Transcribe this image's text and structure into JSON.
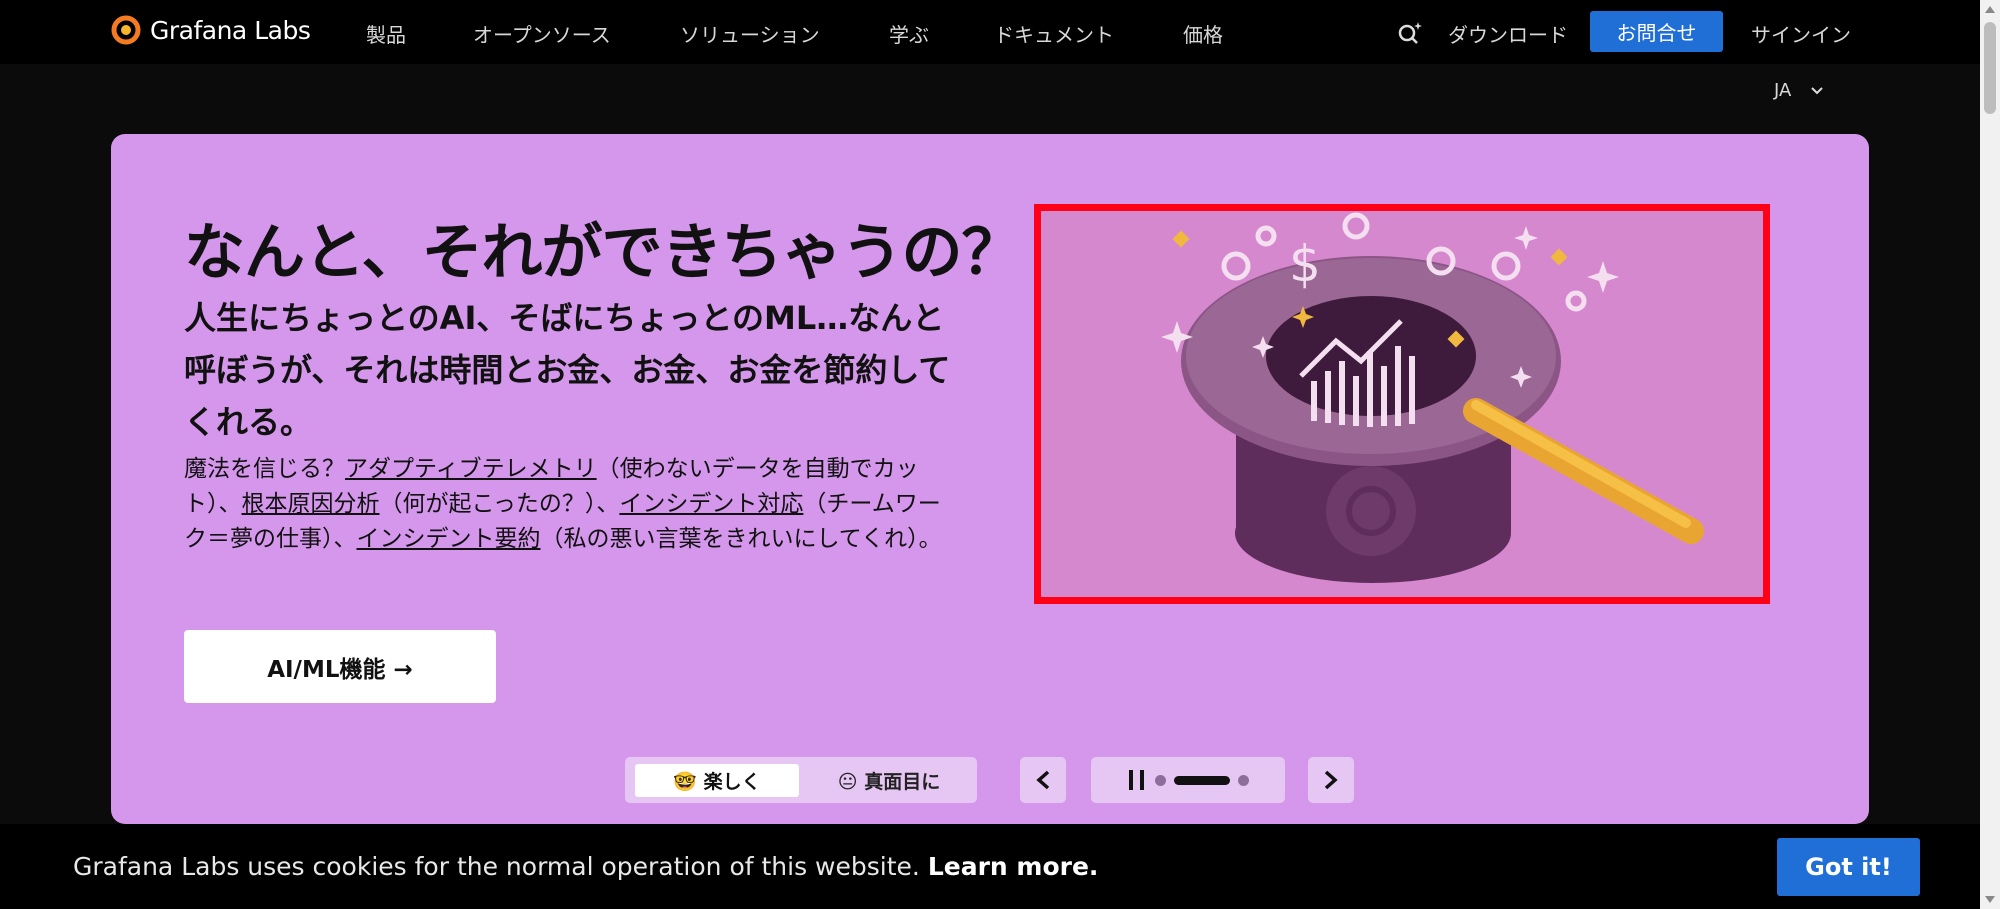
{
  "nav": {
    "brand": "Grafana Labs",
    "links": [
      "製品",
      "オープンソース",
      "ソリューション",
      "学ぶ",
      "ドキュメント",
      "価格"
    ],
    "download": "ダウンロード",
    "contact": "お問合せ",
    "signin": "サインイン",
    "lang": "JA"
  },
  "hero": {
    "title": "なんと、それができちゃうの？",
    "subtitle": "人生にちょっとのAI、そばにちょっとのML…なんと呼ぼうが、それは時間とお金、お金、お金を節約してくれる。",
    "body": {
      "t1": "魔法を信じる？",
      "l1": "アダプティブテレメトリ",
      "t2": "（使わないデータを自動でカット）、",
      "l2": "根本原因分析",
      "t3": "（何が起こったの？）、",
      "l3": "インシデント対応",
      "t4": "（チームワーク＝夢の仕事）、",
      "l4": "インシデント要約",
      "t5": "（私の悪い言葉をきれいにしてくれ）。"
    },
    "cta": "AI/ML機能 →"
  },
  "controls": {
    "fun": "🤓 楽しく",
    "serious": "😐 真面目に"
  },
  "cookie": {
    "text": "Grafana Labs uses cookies for the normal operation of this website.",
    "learn": "Learn more.",
    "button": "Got it!"
  },
  "colors": {
    "hero_bg": "#d497eb",
    "accent_blue": "#1f6fd6",
    "highlight": "#ff0016"
  }
}
